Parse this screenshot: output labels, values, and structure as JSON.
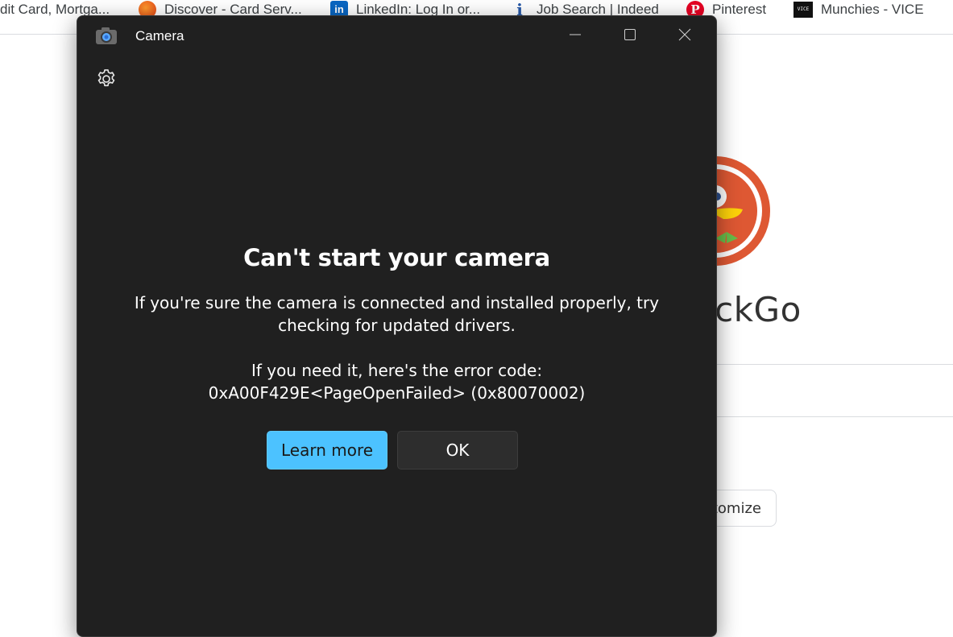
{
  "bookmarks": [
    {
      "label": "dit Card, Mortga...",
      "icon": "bank-icon"
    },
    {
      "label": "Discover - Card Serv...",
      "icon": "discover-icon"
    },
    {
      "label": "LinkedIn: Log In or...",
      "icon": "linkedin-icon"
    },
    {
      "label": "Job Search | Indeed",
      "icon": "indeed-icon"
    },
    {
      "label": "Pinterest",
      "icon": "pinterest-icon"
    },
    {
      "label": "Munchies - VICE",
      "icon": "vice-icon"
    }
  ],
  "background_page": {
    "wordmark_fragment": "uckGo",
    "customize_fragment": "tomize"
  },
  "camera_window": {
    "title": "Camera",
    "heading": "Can't start your camera",
    "message_line1": "If you're sure the camera is connected and installed properly, try",
    "message_line2": "checking for updated drivers.",
    "error_intro": "If you need it, here's the error code:",
    "error_code": "0xA00F429E<PageOpenFailed> (0x80070002)",
    "learn_more_label": "Learn more",
    "ok_label": "OK"
  },
  "colors": {
    "window_bg": "#202020",
    "accent_button": "#4cc2ff",
    "secondary_button": "#2d2d2d",
    "ddg_orange": "#de5833"
  }
}
